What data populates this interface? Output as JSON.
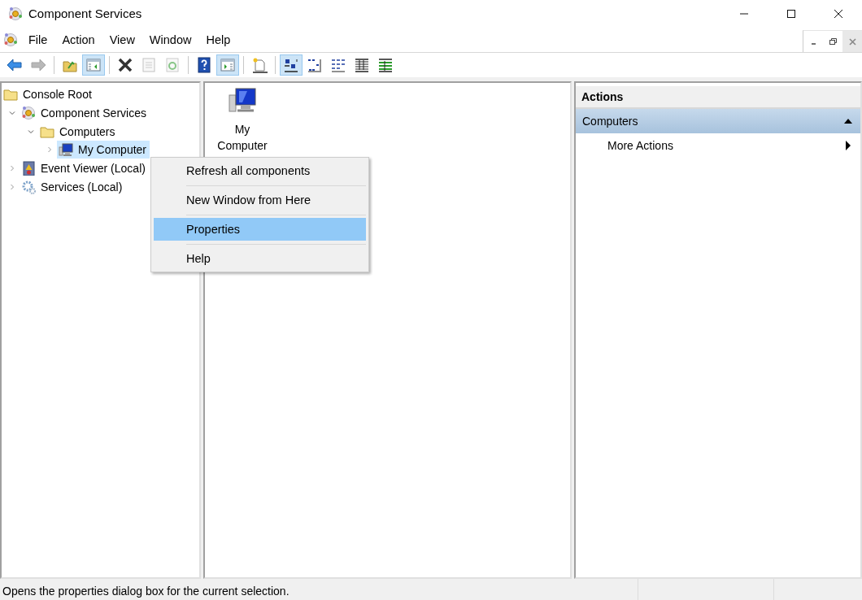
{
  "window": {
    "title": "Component Services"
  },
  "menu_bar": [
    "File",
    "Action",
    "View",
    "Window",
    "Help"
  ],
  "toolbar": [
    {
      "kind": "back",
      "pressed": false,
      "disabled": false
    },
    {
      "kind": "forward",
      "pressed": false,
      "disabled": true
    },
    {
      "kind": "separator"
    },
    {
      "kind": "up",
      "pressed": false,
      "disabled": false
    },
    {
      "kind": "tree",
      "pressed": true,
      "disabled": false
    },
    {
      "kind": "separator"
    },
    {
      "kind": "delete",
      "pressed": false,
      "disabled": false
    },
    {
      "kind": "properties",
      "pressed": false,
      "disabled": true
    },
    {
      "kind": "refresh",
      "pressed": false,
      "disabled": true
    },
    {
      "kind": "separator"
    },
    {
      "kind": "help",
      "pressed": false,
      "disabled": false
    },
    {
      "kind": "actionpane",
      "pressed": true,
      "disabled": false
    },
    {
      "kind": "separator"
    },
    {
      "kind": "newwindow",
      "pressed": false,
      "disabled": false
    },
    {
      "kind": "separator"
    },
    {
      "kind": "largeicons",
      "pressed": true,
      "disabled": false
    },
    {
      "kind": "smallicons",
      "pressed": false,
      "disabled": false
    },
    {
      "kind": "list",
      "pressed": false,
      "disabled": false
    },
    {
      "kind": "details",
      "pressed": false,
      "disabled": false
    },
    {
      "kind": "custom",
      "pressed": false,
      "disabled": false
    }
  ],
  "tree": [
    {
      "label": "Console Root",
      "kind": "folder",
      "selected": false,
      "children": [
        {
          "label": "Component Services",
          "kind": "component",
          "expanded": true,
          "selected": false,
          "children": [
            {
              "label": "Computers",
              "kind": "folder",
              "expanded": true,
              "selected": false,
              "children": [
                {
                  "label": "My Computer",
                  "kind": "computer",
                  "expanded": false,
                  "selected": true
                }
              ]
            }
          ]
        },
        {
          "label": "Event Viewer (Local)",
          "kind": "event",
          "expanded": false,
          "selected": false
        },
        {
          "label": "Services (Local)",
          "kind": "services",
          "expanded": false,
          "selected": false
        }
      ]
    }
  ],
  "content_pane": {
    "items": [
      {
        "label": "My Computer",
        "kind": "computer"
      }
    ]
  },
  "actions_pane": {
    "title": "Actions",
    "sections": [
      {
        "title": "Computers",
        "expanded": true,
        "items": [
          {
            "label": "More Actions",
            "submenu": true
          }
        ]
      }
    ]
  },
  "context_menu": {
    "items": [
      {
        "label": "Refresh all components",
        "selected": false
      },
      {
        "label": "New Window from Here",
        "selected": false
      },
      {
        "label": "Properties",
        "selected": true
      },
      {
        "label": "Help",
        "selected": false
      }
    ]
  },
  "status_bar": {
    "text": "Opens the properties dialog box for the current selection."
  }
}
